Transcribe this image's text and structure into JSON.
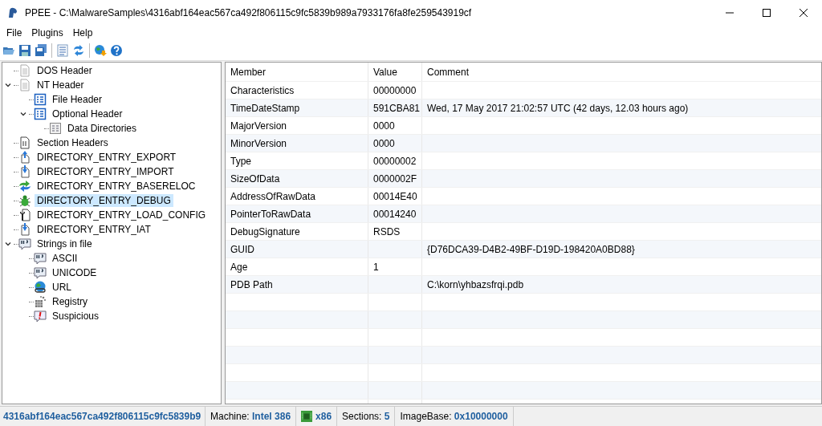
{
  "window": {
    "title": "PPEE - C:\\MalwareSamples\\4316abf164eac567ca492f806115c9fc5839b989a7933176fa8fe259543919cf"
  },
  "menu": [
    {
      "label": "File"
    },
    {
      "label": "Plugins"
    },
    {
      "label": "Help"
    }
  ],
  "toolbar": [
    {
      "kind": "open"
    },
    {
      "kind": "save"
    },
    {
      "kind": "saveall"
    },
    {
      "kind": "sep"
    },
    {
      "kind": "hex"
    },
    {
      "kind": "refresh"
    },
    {
      "kind": "sep"
    },
    {
      "kind": "web"
    },
    {
      "kind": "help"
    }
  ],
  "tree": [
    {
      "label": "DOS Header",
      "kind": "doc",
      "selected": false
    },
    {
      "label": "NT Header",
      "kind": "doc",
      "selected": false,
      "expanded": true,
      "children": [
        {
          "label": "File Header",
          "kind": "struct",
          "selected": false
        },
        {
          "label": "Optional Header",
          "kind": "struct",
          "selected": false,
          "expanded": true,
          "children": [
            {
              "label": "Data Directories",
              "kind": "grid",
              "selected": false
            }
          ]
        }
      ]
    },
    {
      "label": "Section Headers",
      "kind": "section",
      "selected": false
    },
    {
      "label": "DIRECTORY_ENTRY_EXPORT",
      "kind": "export",
      "selected": false
    },
    {
      "label": "DIRECTORY_ENTRY_IMPORT",
      "kind": "import",
      "selected": false
    },
    {
      "label": "DIRECTORY_ENTRY_BASERELOC",
      "kind": "reloc",
      "selected": false
    },
    {
      "label": "DIRECTORY_ENTRY_DEBUG",
      "kind": "debug",
      "selected": true
    },
    {
      "label": "DIRECTORY_ENTRY_LOAD_CONFIG",
      "kind": "config",
      "selected": false
    },
    {
      "label": "DIRECTORY_ENTRY_IAT",
      "kind": "import",
      "selected": false
    },
    {
      "label": "Strings in file",
      "kind": "strings",
      "selected": false,
      "expanded": true,
      "children": [
        {
          "label": "ASCII",
          "kind": "strings",
          "selected": false
        },
        {
          "label": "UNICODE",
          "kind": "strings",
          "selected": false
        },
        {
          "label": "URL",
          "kind": "url",
          "selected": false
        },
        {
          "label": "Registry",
          "kind": "registry",
          "selected": false
        },
        {
          "label": "Suspicious",
          "kind": "suspicious",
          "selected": false
        }
      ]
    }
  ],
  "table": {
    "columns": [
      "Member",
      "Value",
      "Comment"
    ],
    "rows": [
      [
        "Characteristics",
        "00000000",
        ""
      ],
      [
        "TimeDateStamp",
        "591CBA81",
        "Wed, 17 May 2017 21:02:57 UTC (42 days, 12.03 hours ago)"
      ],
      [
        "MajorVersion",
        "0000",
        ""
      ],
      [
        "MinorVersion",
        "0000",
        ""
      ],
      [
        "Type",
        "00000002",
        ""
      ],
      [
        "SizeOfData",
        "0000002F",
        ""
      ],
      [
        "AddressOfRawData",
        "00014E40",
        ""
      ],
      [
        "PointerToRawData",
        "00014240",
        ""
      ],
      [
        "DebugSignature",
        "RSDS",
        ""
      ],
      [
        "GUID",
        "",
        "{D76DCA39-D4B2-49BF-D19D-198420A0BD88}"
      ],
      [
        "Age",
        "1",
        ""
      ],
      [
        "PDB Path",
        "",
        "C:\\korn\\yhbazsfrqi.pdb"
      ]
    ]
  },
  "status_bar": [
    {
      "text": "4316abf164eac567ca492f806115c9fc5839b9",
      "kind": "hash"
    },
    {
      "text": "Machine: **Intel 386**",
      "kind": "text"
    },
    {
      "text": "**x86**",
      "kind": "chip"
    },
    {
      "text": "Sections: **5**",
      "kind": "text"
    },
    {
      "text": "ImageBase: **0x10000000**",
      "kind": "text"
    }
  ]
}
